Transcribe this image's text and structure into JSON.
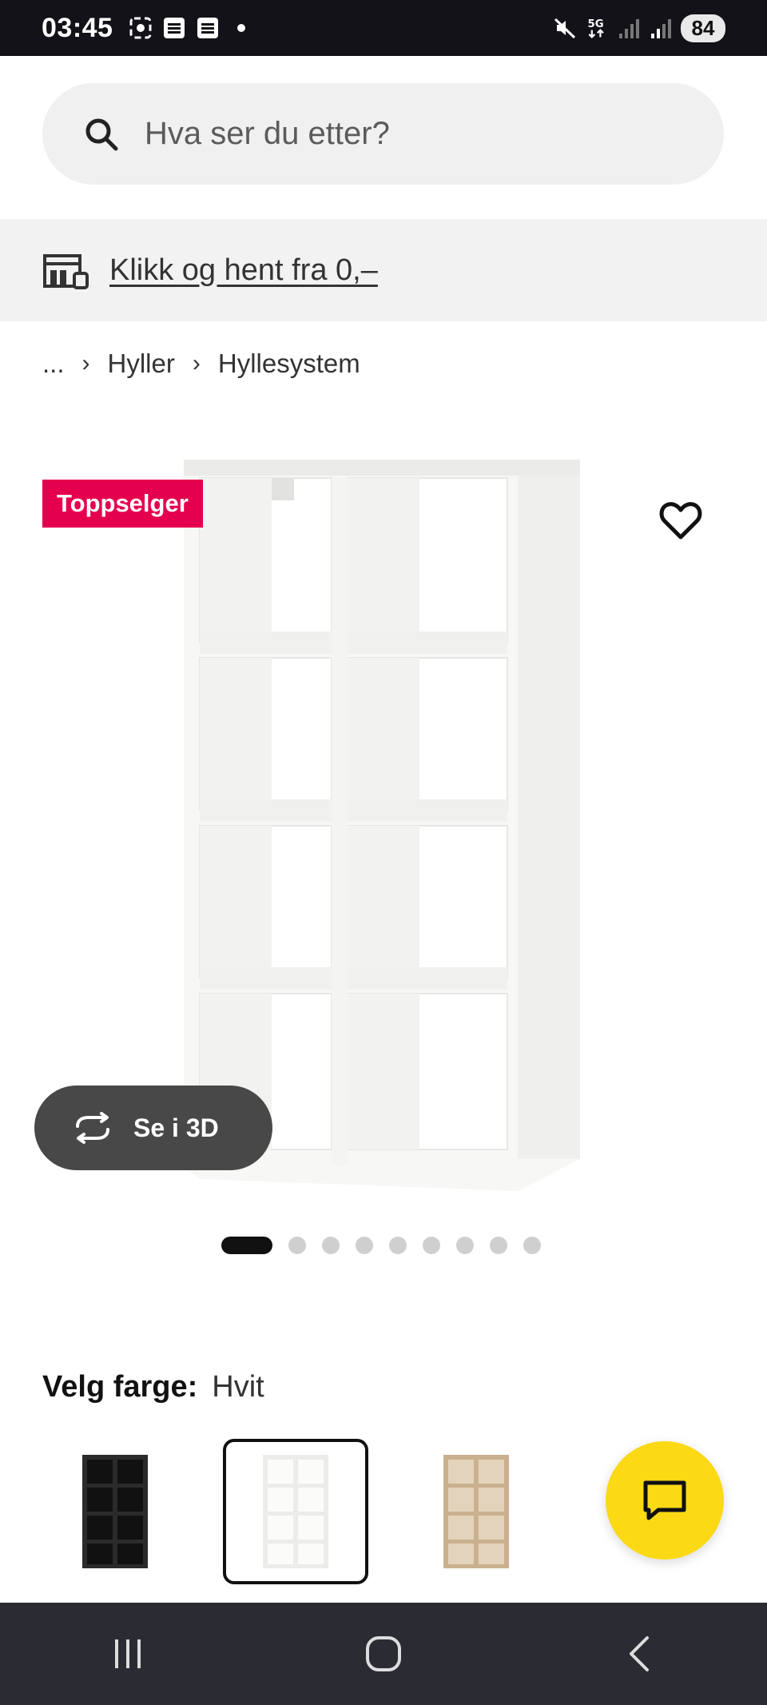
{
  "status_bar": {
    "time": "03:45",
    "network": "5G",
    "battery": "84",
    "icons": [
      "screenshot-icon",
      "notification-icon",
      "notification-icon",
      "mute-icon",
      "5g-icon",
      "signal-icon",
      "signal-icon"
    ]
  },
  "search": {
    "placeholder": "Hva ser du etter?"
  },
  "banner": {
    "link_text": "Klikk og hent fra 0,–"
  },
  "breadcrumb": {
    "items": [
      "...",
      "Hyller",
      "Hyllesystem"
    ]
  },
  "product": {
    "badge": "Toppselger",
    "view_3d_label": "Se i 3D",
    "image_count": 9,
    "active_image_index": 0
  },
  "color": {
    "label": "Velg farge:",
    "selected": "Hvit",
    "options": [
      {
        "name": "black-brown",
        "color": "#2b2b2b"
      },
      {
        "name": "white",
        "color": "#f4f4f4"
      },
      {
        "name": "oak",
        "color": "#c9b08f"
      }
    ]
  },
  "colors": {
    "badge": "#e5004f",
    "chat_fab": "#fbd914",
    "status_bar": "#121218",
    "nav_bar": "#2b2b33"
  }
}
